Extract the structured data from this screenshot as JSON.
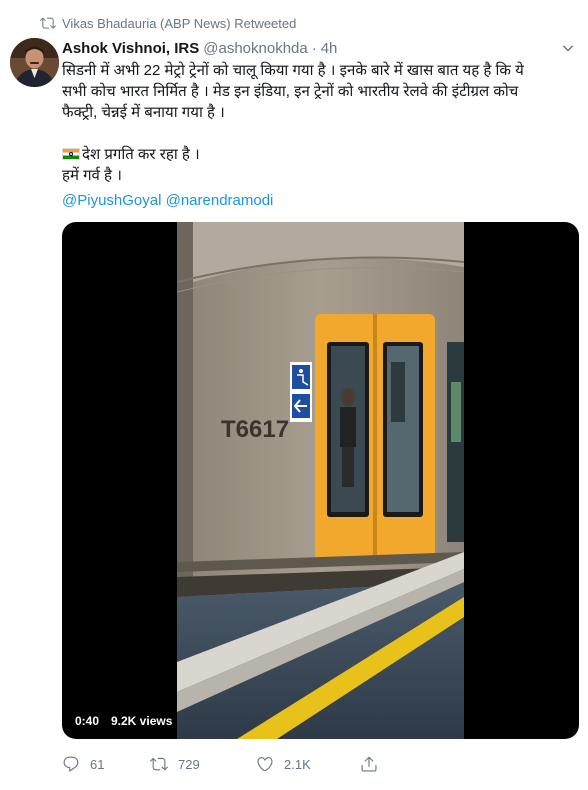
{
  "retweet_context": {
    "text": "Vikas Bhadauria (ABP News) Retweeted",
    "icon": "retweet-icon"
  },
  "tweet": {
    "display_name": "Ashok Vishnoi, IRS",
    "handle": "@ashoknokhda",
    "separator": "·",
    "time": "4h",
    "text_lines": [
      "सिडनी में अभी 22 मेट्रो ट्रेनों को चालू किया गया है । इनके बारे में खास बात यह है कि ये",
      "सभी कोच भारत निर्मित है । मेड इन इंडिया, इन ट्रेनों को भारतीय रेलवे की इंटीग्रल कोच",
      "फैक्ट्री, चेन्नई में बनाया गया है ।"
    ],
    "line_flag": "देश प्रगति कर रहा है ।",
    "line_proud": "हमें गर्व है ।",
    "mentions": [
      "@PiyushGoyal",
      "@narendramodi"
    ]
  },
  "video": {
    "duration": "0:40",
    "views": "9.2K views",
    "train_number": "T6617",
    "door_color": "#f2a82c",
    "platform_line_color": "#e8c21a"
  },
  "actions": {
    "reply_count": "61",
    "retweet_count": "729",
    "like_count": "2.1K"
  },
  "colors": {
    "link": "#1b95e0",
    "muted": "#657786",
    "text": "#14171a"
  }
}
